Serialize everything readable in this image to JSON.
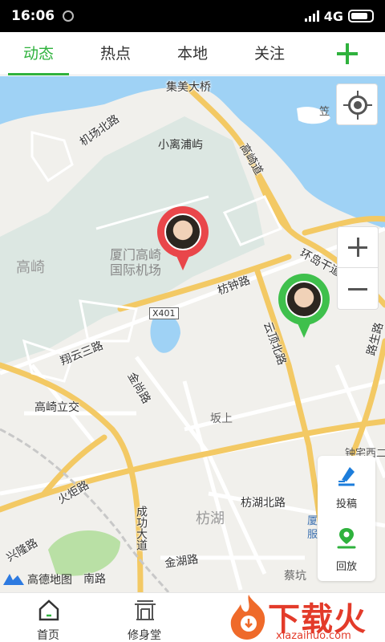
{
  "status_bar": {
    "time": "16:06",
    "network": "4G"
  },
  "tabs": [
    {
      "label": "动态",
      "active": true
    },
    {
      "label": "热点",
      "active": false
    },
    {
      "label": "本地",
      "active": false
    },
    {
      "label": "关注",
      "active": false
    }
  ],
  "accent_color": "#2fb23d",
  "map": {
    "labels": {
      "jimei_bridge": "集美大桥",
      "jichang_n": "机场北路",
      "xiaoli": "小离浦屿",
      "gaoqi_road": "高崎道",
      "gaoqi": "高崎",
      "airport_1": "厦门高崎",
      "airport_2": "国际机场",
      "huandao": "环岛干道",
      "fangzhong": "枋钟路",
      "x401": "X401",
      "yunding": "云顶北路",
      "xiangyun": "翔云三路",
      "jinshang": "金尚路",
      "gaoqi_lijiao": "高崎立交",
      "banshang": "坂上",
      "zhongzhai": "钟宅西二",
      "lutong": "路生路",
      "huoju": "火炬路",
      "chenggong": "成功大道",
      "fanghu": "枋湖",
      "fanghu_n": "枋湖北路",
      "xiamen_gov": "厦门市行政",
      "gov2": "服",
      "jinhu": "金湖路",
      "caikeng": "蔡坑",
      "xinglong": "兴隆路",
      "nanlu": "南路",
      "island": "笠"
    },
    "pins": [
      {
        "name": "user-pin-red",
        "color": "#e9464a"
      },
      {
        "name": "user-pin-green",
        "color": "#3fc04c"
      }
    ],
    "logo_text": "高德地图"
  },
  "side_actions": [
    {
      "label": "投稿",
      "icon": "post-icon"
    },
    {
      "label": "回放",
      "icon": "playback-icon"
    }
  ],
  "bottom_nav": [
    {
      "label": "首页",
      "icon": "home-icon"
    },
    {
      "label": "修身堂",
      "icon": "temple-icon"
    }
  ],
  "watermark": {
    "title": "下载火",
    "url": "xiazaihuo.com"
  }
}
